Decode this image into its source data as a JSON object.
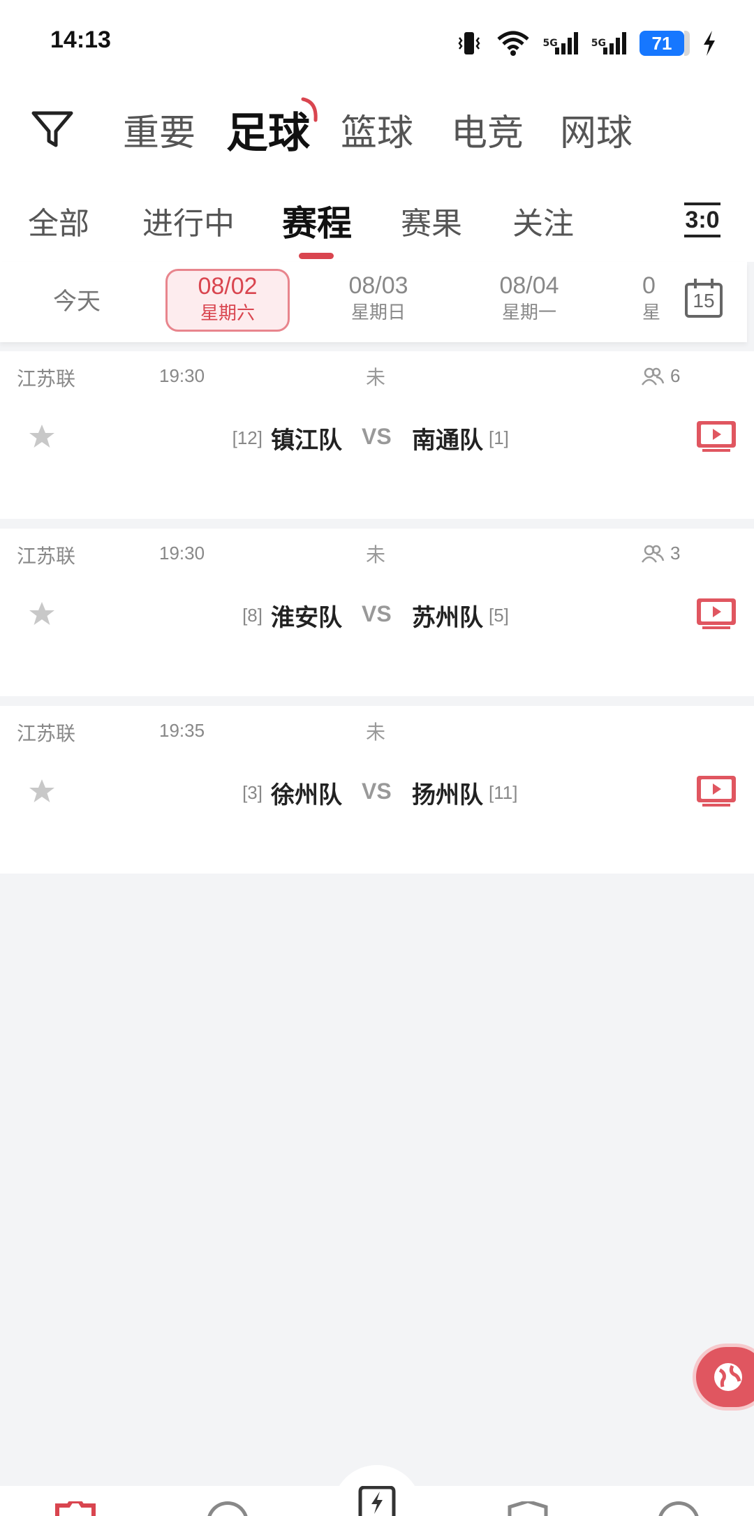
{
  "status_bar": {
    "time": "14:13",
    "battery": "71",
    "signal1": "5G",
    "signal2": "5G"
  },
  "sports_tabs": [
    {
      "label": "重要",
      "active": false
    },
    {
      "label": "足球",
      "active": true
    },
    {
      "label": "篮球",
      "active": false
    },
    {
      "label": "电竞",
      "active": false
    },
    {
      "label": "网球",
      "active": false
    }
  ],
  "sub_tabs": [
    {
      "label": "全部",
      "active": false
    },
    {
      "label": "进行中",
      "active": false
    },
    {
      "label": "赛程",
      "active": true
    },
    {
      "label": "赛果",
      "active": false
    },
    {
      "label": "关注",
      "active": false
    }
  ],
  "score_button": "3:0",
  "dates": [
    {
      "label": "今天"
    },
    {
      "date": "08/02",
      "weekday": "星期六",
      "active": true
    },
    {
      "date": "08/03",
      "weekday": "星期日"
    },
    {
      "date": "08/04",
      "weekday": "星期一"
    },
    {
      "date": "0",
      "weekday": "星"
    }
  ],
  "calendar_day": "15",
  "matches": [
    {
      "league": "江苏联",
      "time": "19:30",
      "status": "未",
      "viewers": "6",
      "home_rank": "[12]",
      "home": "镇江队",
      "vs": "VS",
      "away": "南通队",
      "away_rank": "[1]"
    },
    {
      "league": "江苏联",
      "time": "19:30",
      "status": "未",
      "viewers": "3",
      "home_rank": "[8]",
      "home": "淮安队",
      "vs": "VS",
      "away": "苏州队",
      "away_rank": "[5]"
    },
    {
      "league": "江苏联",
      "time": "19:35",
      "status": "未",
      "viewers": "",
      "home_rank": "[3]",
      "home": "徐州队",
      "vs": "VS",
      "away": "扬州队",
      "away_rank": "[11]"
    }
  ],
  "colors": {
    "accent": "#d9454f",
    "background": "#f3f4f6",
    "battery": "#1677ff"
  }
}
